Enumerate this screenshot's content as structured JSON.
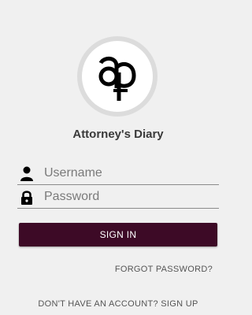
{
  "app": {
    "title": "Attorney's Diary",
    "logo": "ap-monogram-logo"
  },
  "form": {
    "username_placeholder": "Username",
    "password_placeholder": "Password",
    "username_icon": "person-icon",
    "password_icon": "lock-icon"
  },
  "actions": {
    "sign_in": "SIGN IN",
    "forgot_password": "FORGOT PASSWORD?",
    "sign_up_prompt": "DON'T HAVE AN ACCOUNT? SIGN UP"
  },
  "colors": {
    "primary_button": "#3d0a26",
    "background": "#f0f0f0"
  }
}
